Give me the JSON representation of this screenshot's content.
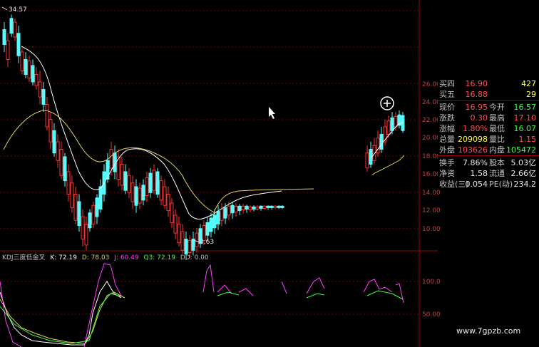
{
  "chart": {
    "price_axis_ticks": [
      "26.00",
      "24.00",
      "22.00",
      "20.00",
      "18.00",
      "16.00",
      "14.00",
      "12.00",
      "10.00"
    ],
    "high_marker": "34.57",
    "low_marker": "8.63",
    "kdj_axis_ticks": [
      "100.0",
      "50.00"
    ],
    "colors": {
      "up": "#ff3030",
      "down": "#54fcfc",
      "ma_short": "#ffffff",
      "ma_long": "#e0d060",
      "grid": "#800000",
      "kdj_k": "#ffffff",
      "kdj_d": "#e0d060",
      "kdj_j": "#ff40ff",
      "kdj_q3": "#40ff40"
    }
  },
  "kdj": {
    "title": "KDJ三度低金叉",
    "k": "K: 72.19",
    "d": "D: 78.03",
    "j": "J: 60.49",
    "q3": "Q3: 72.19",
    "dd": "DD: 0.00"
  },
  "quote": {
    "rows": [
      {
        "l1": "买四",
        "v1": "16.90",
        "v1c": "red",
        "l2": "",
        "v2": "427",
        "v2c": "yellow"
      },
      {
        "l1": "买五",
        "v1": "16.88",
        "v1c": "red",
        "l2": "",
        "v2": "29",
        "v2c": "yellow"
      },
      {
        "l1": "现价",
        "v1": "16.95",
        "v1c": "red",
        "l2": "今开",
        "v2": "16.57",
        "v2c": "green"
      },
      {
        "l1": "涨跌",
        "v1": "0.30",
        "v1c": "red",
        "l2": "最高",
        "v2": "17.10",
        "v2c": "red"
      },
      {
        "l1": "涨幅",
        "v1": "1.80%",
        "v1c": "red",
        "l2": "最低",
        "v2": "16.07",
        "v2c": "green"
      },
      {
        "l1": "总量",
        "v1": "209098",
        "v1c": "yellow",
        "l2": "量比",
        "v2": "1.15",
        "v2c": "red"
      },
      {
        "l1": "外盘",
        "v1": "103626",
        "v1c": "red",
        "l2": "内盘",
        "v2": "105472",
        "v2c": "green"
      },
      {
        "l1": "换手",
        "v1": "7.86%",
        "v1c": "white",
        "l2": "股本",
        "v2": "5.03亿",
        "v2c": "white"
      },
      {
        "l1": "净资",
        "v1": "1.58",
        "v1c": "white",
        "l2": "流通",
        "v2": "2.66亿",
        "v2c": "white"
      },
      {
        "l1": "收益(三)",
        "v1": "0.054",
        "v1c": "white",
        "l2": "PE(动)",
        "v2": "234.2",
        "v2c": "white"
      }
    ]
  },
  "watermark": "www.7gpzb.com"
}
